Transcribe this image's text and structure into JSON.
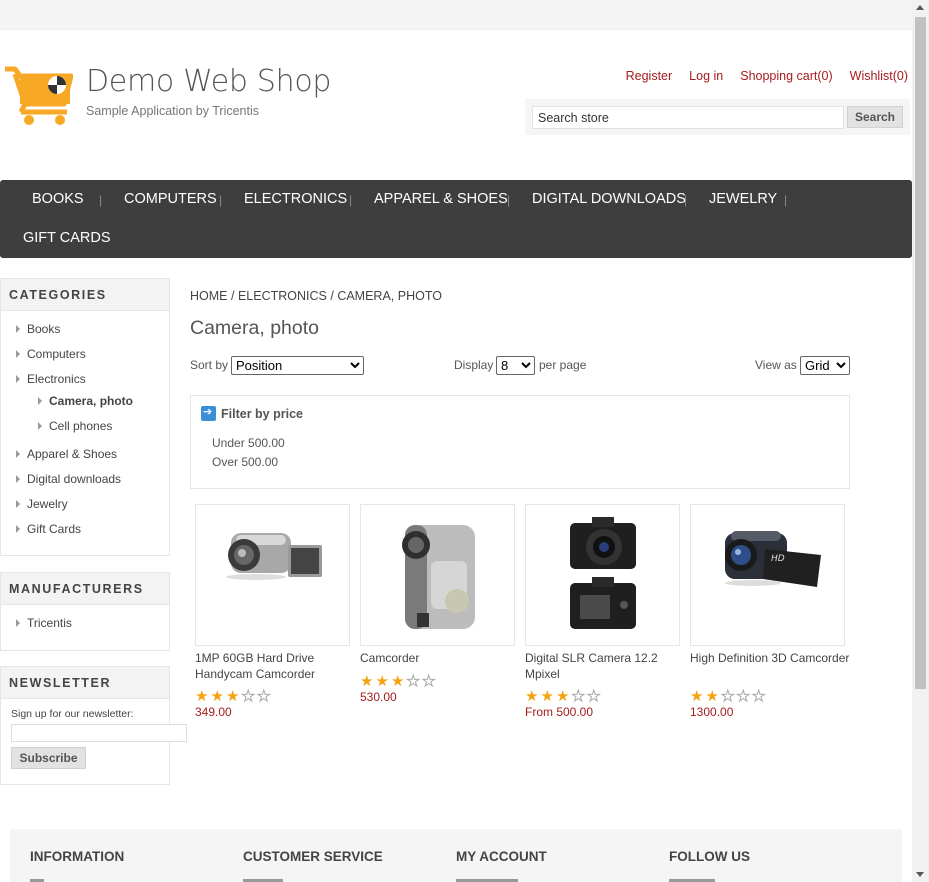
{
  "header": {
    "logo_name": "Demo Web Shop",
    "logo_tagline": "Sample Application by Tricentis",
    "links": [
      "Register",
      "Log in",
      "Shopping cart(0)",
      "Wishlist(0)"
    ],
    "search_placeholder": "Search store",
    "search_value": "Search store",
    "search_button": "Search"
  },
  "menu": [
    "BOOKS",
    "COMPUTERS",
    "ELECTRONICS",
    "APPAREL & SHOES",
    "DIGITAL DOWNLOADS",
    "JEWELRY",
    "GIFT CARDS"
  ],
  "sidebar": {
    "categories_title": "CATEGORIES",
    "categories": [
      "Books",
      "Computers",
      "Electronics",
      "Camera, photo",
      "Cell phones",
      "Apparel & Shoes",
      "Digital downloads",
      "Jewelry",
      "Gift Cards"
    ],
    "manufacturers_title": "MANUFACTURERS",
    "manufacturers": [
      "Tricentis"
    ],
    "newsletter_title": "NEWSLETTER",
    "newsletter_label": "Sign up for our newsletter:",
    "subscribe_button": "Subscribe"
  },
  "main": {
    "breadcrumb": [
      "HOME",
      "ELECTRONICS",
      "CAMERA, PHOTO"
    ],
    "breadcrumb_sep": "/",
    "title": "Camera, photo",
    "sort_label": "Sort by",
    "sort_value": "Position",
    "display_label": "Display",
    "display_value": "8",
    "per_page_label": "per page",
    "view_label": "View as",
    "view_value": "Grid",
    "filter_title": "Filter by price",
    "filter_options": [
      "Under 500.00",
      "Over 500.00"
    ]
  },
  "products": [
    {
      "name": "1MP 60GB Hard Drive Handycam Camcorder",
      "rating": 3,
      "price": "349.00",
      "image": "silver-handycam"
    },
    {
      "name": "Camcorder",
      "rating": 3,
      "price": "530.00",
      "image": "silver-camcorder"
    },
    {
      "name": "Digital SLR Camera 12.2 Mpixel",
      "rating": 3,
      "price": "From 500.00",
      "image": "dslr-camera"
    },
    {
      "name": "High Definition 3D Camcorder",
      "rating": 2,
      "price": "1300.00",
      "image": "hd-camcorder"
    }
  ],
  "footer": {
    "columns": [
      "INFORMATION",
      "CUSTOMER SERVICE",
      "MY ACCOUNT",
      "FOLLOW US"
    ]
  },
  "colors": {
    "accent_red": "#a51c1c",
    "menu_bg": "#3e3e3e",
    "star_gold": "#f2a30f",
    "logo_orange": "#f7a825"
  }
}
